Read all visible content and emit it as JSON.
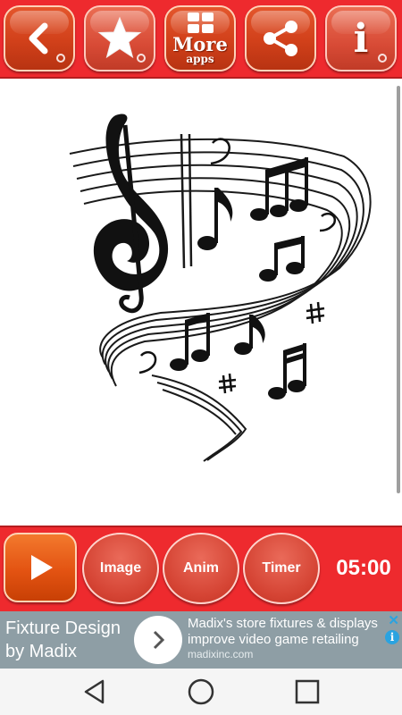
{
  "toolbar": {
    "back": "back-arrow-icon",
    "rate": "star-icon",
    "more_label": "More",
    "more_sublabel": "apps",
    "share": "share-icon",
    "info_label": "i"
  },
  "canvas": {
    "image": "music-notes-staff-illustration"
  },
  "controls": {
    "play": "play-icon",
    "image_label": "Image",
    "anim_label": "Anim",
    "timer_label": "Timer",
    "timer_value": "05:00"
  },
  "ad": {
    "left_text": "Fixture Design by Madix",
    "title": "Madix's store fixtures & displays improve video game retailing",
    "url": "madixinc.com",
    "close_label": "✕",
    "info_label": "i"
  },
  "navbar": {
    "back": "nav-back-icon",
    "home": "nav-home-icon",
    "recents": "nav-recents-icon"
  },
  "colors": {
    "toolbar_red": "#ee2a2e",
    "button_orange": "#d1401a",
    "ad_bg": "#8e9ea5"
  }
}
